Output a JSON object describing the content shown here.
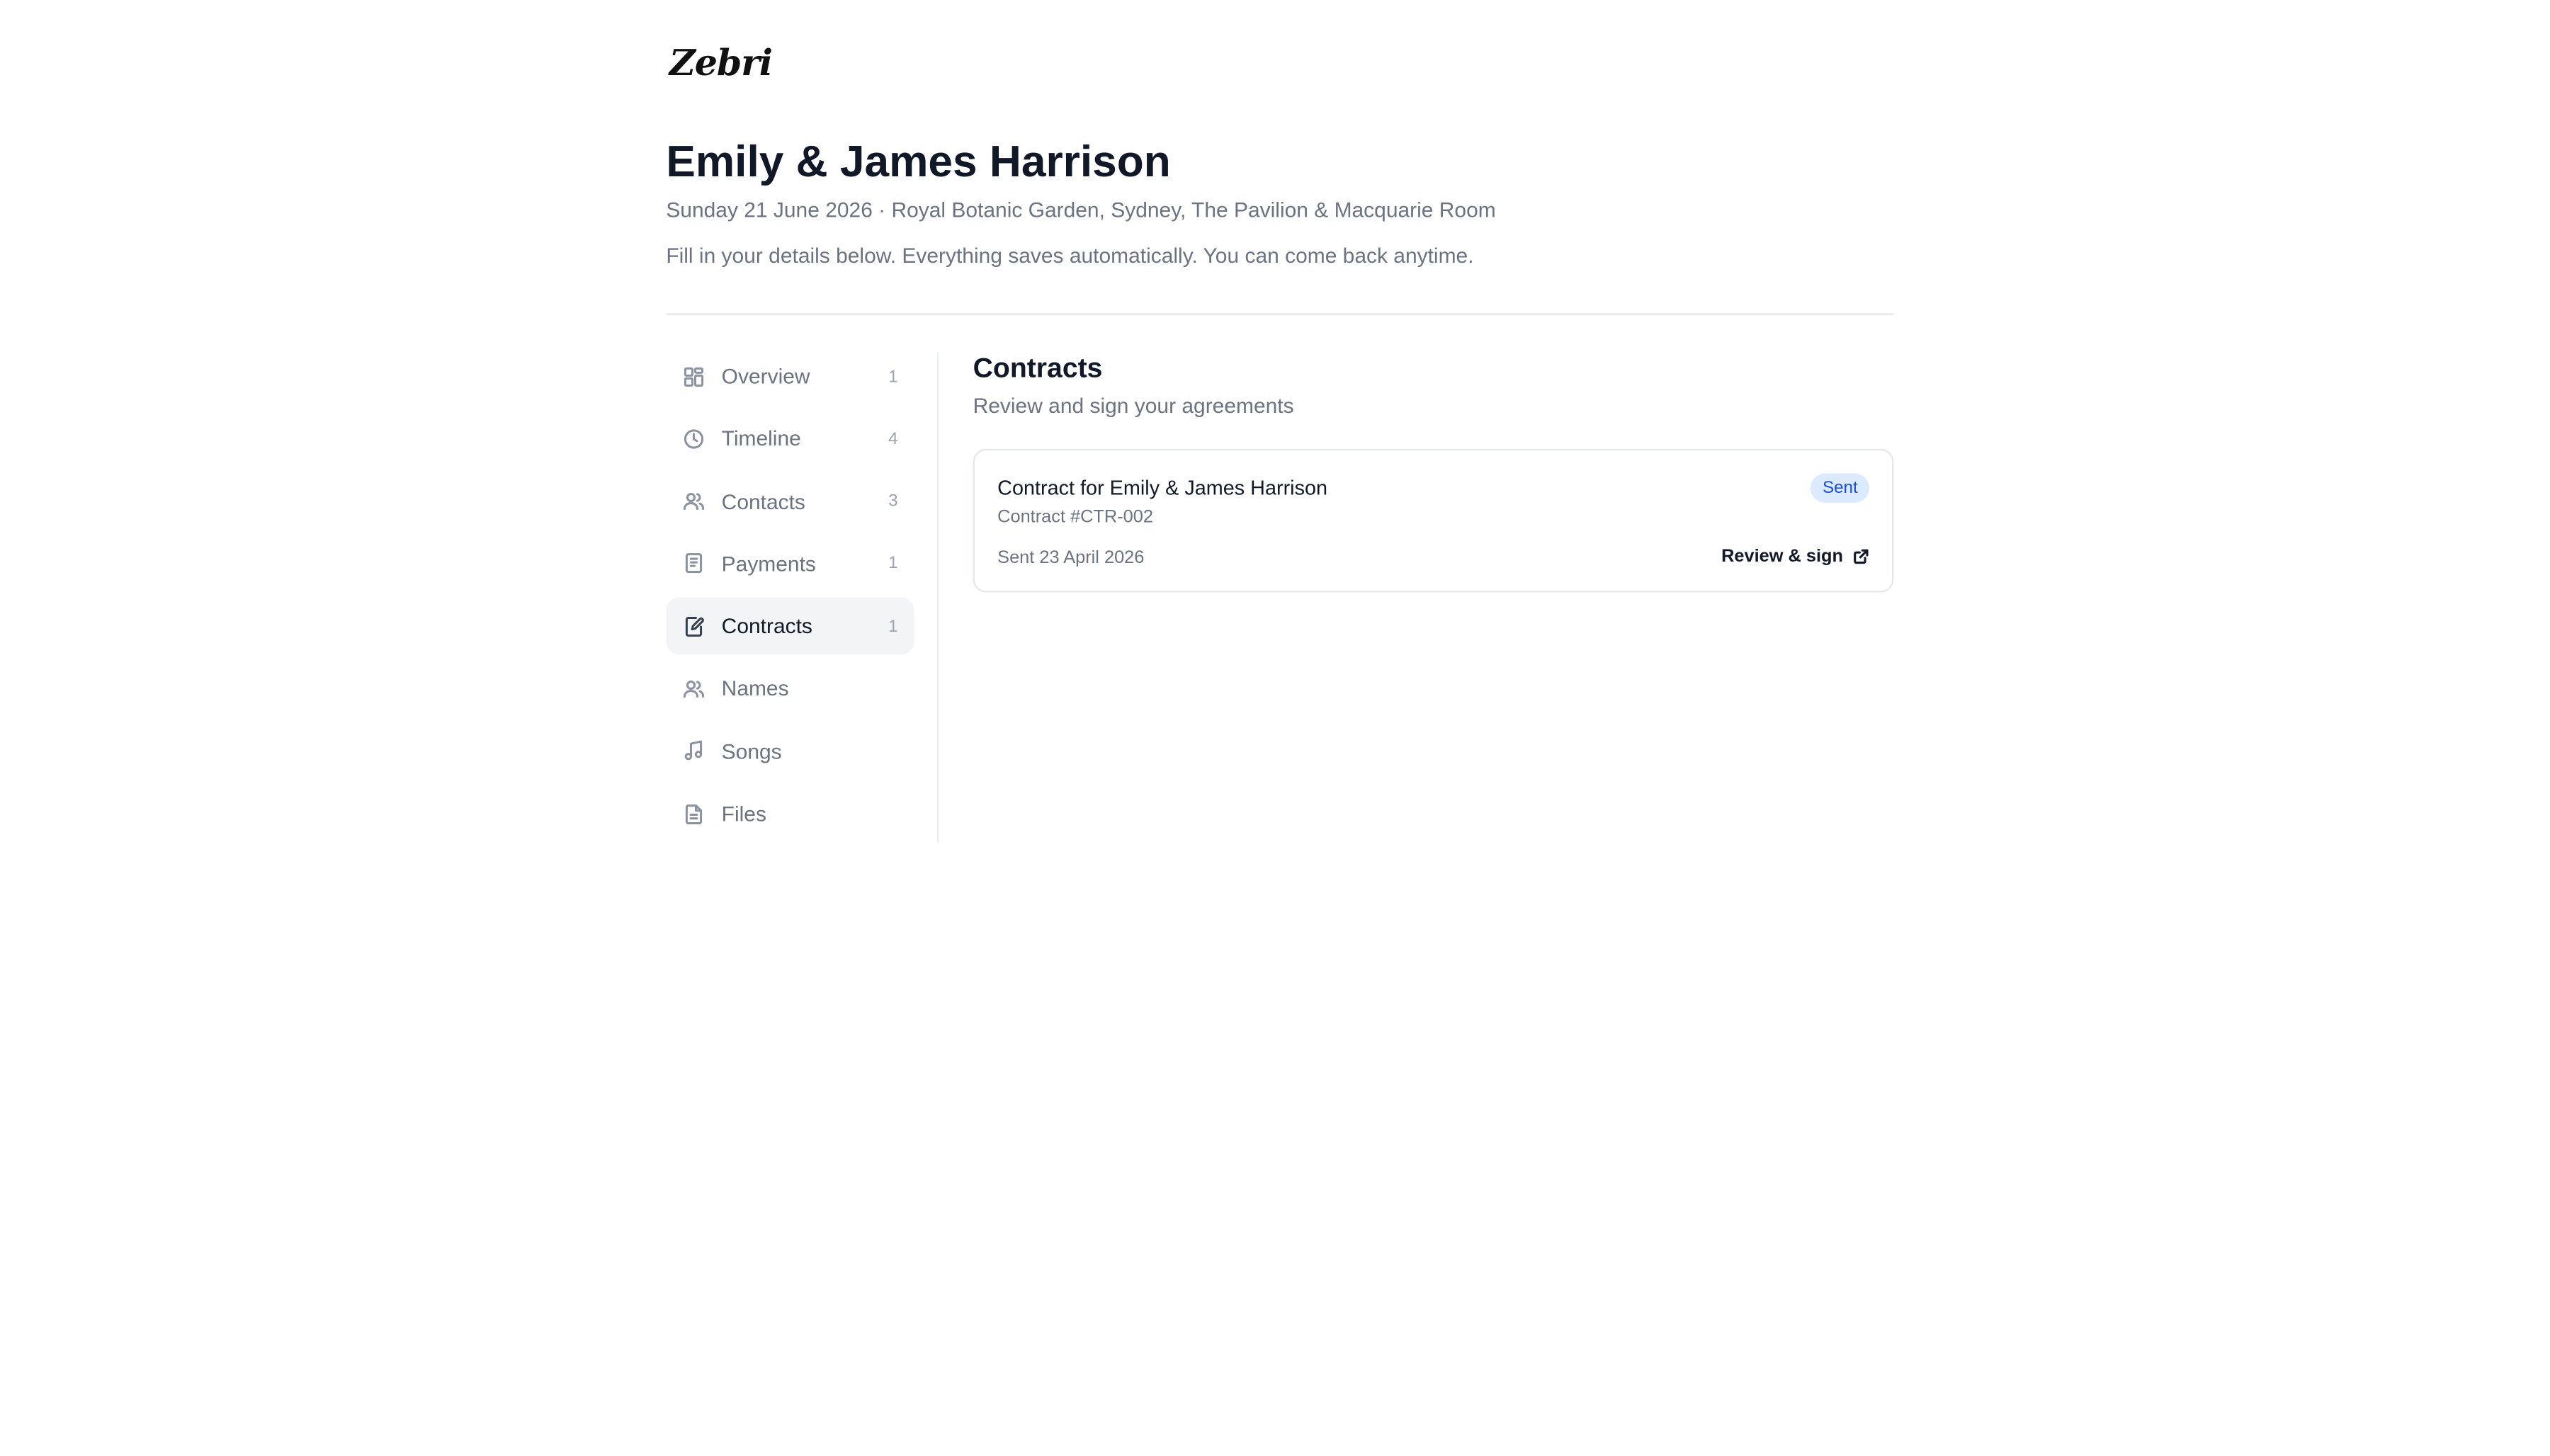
{
  "brand": {
    "logo_text": "Zebri"
  },
  "header": {
    "title": "Emily & James Harrison",
    "subtitle": "Sunday 21 June 2026 · Royal Botanic Garden, Sydney, The Pavilion & Macquarie Room",
    "intro": "Fill in your details below. Everything saves automatically. You can come back anytime."
  },
  "sidebar": {
    "active": "Contracts",
    "items": [
      {
        "label": "Overview",
        "count": "1",
        "icon": "grid-icon"
      },
      {
        "label": "Timeline",
        "count": "4",
        "icon": "clock-icon"
      },
      {
        "label": "Contacts",
        "count": "3",
        "icon": "users-icon"
      },
      {
        "label": "Payments",
        "count": "1",
        "icon": "receipt-icon"
      },
      {
        "label": "Contracts",
        "count": "1",
        "icon": "file-signature-icon"
      },
      {
        "label": "Names",
        "count": "",
        "icon": "users-icon"
      },
      {
        "label": "Songs",
        "count": "",
        "icon": "music-icon"
      },
      {
        "label": "Files",
        "count": "",
        "icon": "file-text-icon"
      }
    ]
  },
  "main": {
    "section_title": "Contracts",
    "section_subtitle": "Review and sign your agreements",
    "contract": {
      "title": "Contract for Emily & James Harrison",
      "number": "Contract #CTR-002",
      "status": "Sent",
      "sent_date": "Sent 23 April 2026",
      "action_label": "Review & sign",
      "action_icon": "external-link-icon"
    }
  },
  "colors": {
    "badge_bg": "#dbeafe",
    "badge_text": "#1d4ed8",
    "active_nav_bg": "#f3f4f6"
  }
}
